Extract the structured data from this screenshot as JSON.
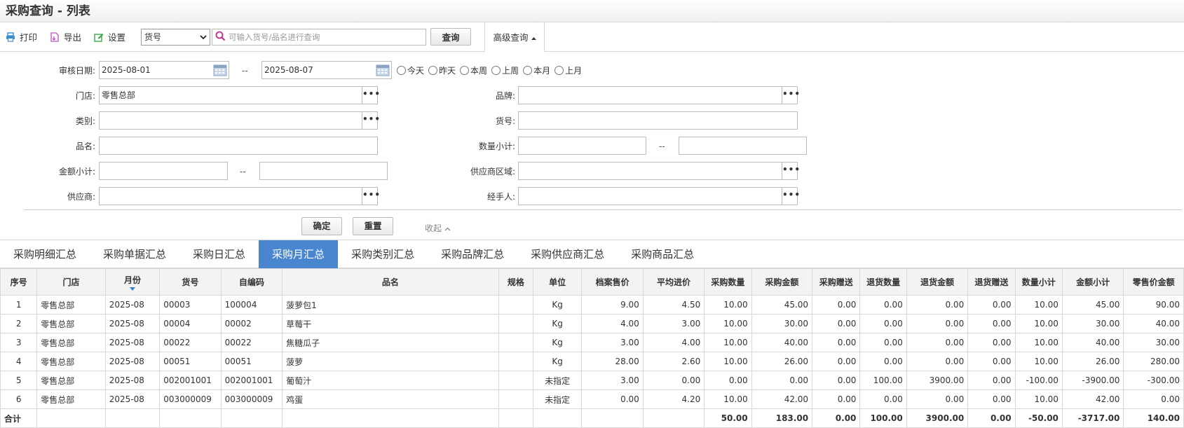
{
  "title": "采购查询 - 列表",
  "toolbar": {
    "print": "打印",
    "export": "导出",
    "settings": "设置",
    "field_select": "货号",
    "search_placeholder": "可输入货号/品名进行查询",
    "query": "查询",
    "advanced": "高级查询"
  },
  "filter": {
    "audit_date_label": "审核日期:",
    "date_from": "2025-08-01",
    "date_sep": "--",
    "date_to": "2025-08-07",
    "quick_dates": [
      "今天",
      "昨天",
      "本周",
      "上周",
      "本月",
      "上月"
    ],
    "store_label": "门店:",
    "store_value": "零售总部",
    "brand_label": "品牌:",
    "category_label": "类别:",
    "item_no_label": "货号:",
    "name_label": "品名:",
    "qty_subtotal_label": "数量小计:",
    "amount_subtotal_label": "金额小计:",
    "supplier_region_label": "供应商区域:",
    "supplier_label": "供应商:",
    "handler_label": "经手人:",
    "more": "•••",
    "confirm": "确定",
    "reset": "重置",
    "collapse": "收起"
  },
  "tabs": [
    "采购明细汇总",
    "采购单据汇总",
    "采购日汇总",
    "采购月汇总",
    "采购类别汇总",
    "采购品牌汇总",
    "采购供应商汇总",
    "采购商品汇总"
  ],
  "active_tab": 3,
  "table": {
    "headers": [
      "序号",
      "门店",
      "月份",
      "货号",
      "自编码",
      "品名",
      "规格",
      "单位",
      "档案售价",
      "平均进价",
      "采购数量",
      "采购金额",
      "采购赠送",
      "退货数量",
      "退货金额",
      "退货赠送",
      "数量小计",
      "金额小计",
      "零售价金额"
    ],
    "rows": [
      [
        "1",
        "零售总部",
        "2025-08",
        "00003",
        "100004",
        "菠萝包1",
        "",
        "Kg",
        "9.00",
        "4.50",
        "10.00",
        "45.00",
        "0.00",
        "0.00",
        "0.00",
        "0.00",
        "10.00",
        "45.00",
        "90.00"
      ],
      [
        "2",
        "零售总部",
        "2025-08",
        "00004",
        "00002",
        "草莓干",
        "",
        "Kg",
        "4.00",
        "3.00",
        "10.00",
        "30.00",
        "0.00",
        "0.00",
        "0.00",
        "0.00",
        "10.00",
        "30.00",
        "40.00"
      ],
      [
        "3",
        "零售总部",
        "2025-08",
        "00022",
        "00022",
        "焦糖瓜子",
        "",
        "Kg",
        "3.00",
        "4.00",
        "10.00",
        "40.00",
        "0.00",
        "0.00",
        "0.00",
        "0.00",
        "10.00",
        "40.00",
        "30.00"
      ],
      [
        "4",
        "零售总部",
        "2025-08",
        "00051",
        "00051",
        "菠萝",
        "",
        "Kg",
        "28.00",
        "2.60",
        "10.00",
        "26.00",
        "0.00",
        "0.00",
        "0.00",
        "0.00",
        "10.00",
        "26.00",
        "280.00"
      ],
      [
        "5",
        "零售总部",
        "2025-08",
        "002001001",
        "002001001",
        "葡萄汁",
        "",
        "未指定",
        "3.00",
        "0.00",
        "0.00",
        "0.00",
        "0.00",
        "100.00",
        "3900.00",
        "0.00",
        "-100.00",
        "-3900.00",
        "-300.00"
      ],
      [
        "6",
        "零售总部",
        "2025-08",
        "003000009",
        "003000009",
        "鸡蛋",
        "",
        "未指定",
        "0.00",
        "4.20",
        "10.00",
        "42.00",
        "0.00",
        "0.00",
        "0.00",
        "0.00",
        "10.00",
        "42.00",
        "0.00"
      ]
    ],
    "total": [
      "合计",
      "",
      "",
      "",
      "",
      "",
      "",
      "",
      "",
      "",
      "50.00",
      "183.00",
      "0.00",
      "100.00",
      "3900.00",
      "0.00",
      "-50.00",
      "-3717.00",
      "140.00"
    ]
  }
}
